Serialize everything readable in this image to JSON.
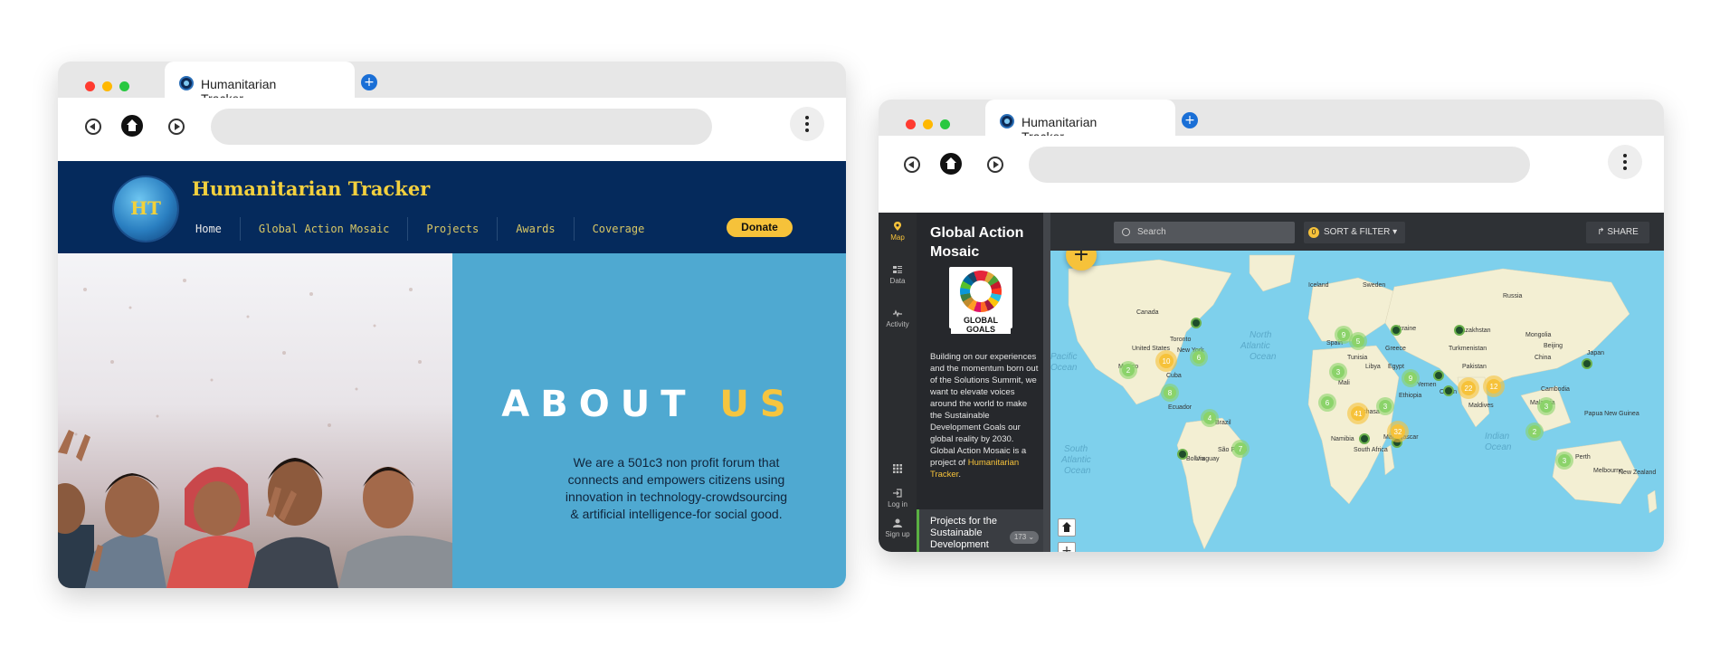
{
  "left_window": {
    "tab_title": "Humanitarian Tracker",
    "site": {
      "title": "Humanitarian Tracker",
      "logo_text": "HT",
      "nav": [
        "Home",
        "Global Action Mosaic",
        "Projects",
        "Awards",
        "Coverage"
      ],
      "donate_label": "Donate",
      "about_heading_part1": "ABOUT",
      "about_heading_part2": "US",
      "about_text": "We are a 501c3 non profit forum that connects and empowers citizens using innovation in technology-crowdsourcing & artificial intelligence-for social good."
    }
  },
  "right_window": {
    "tab_title": "Humanitarian Tracker",
    "rail": [
      {
        "label": "Map",
        "icon": "map-pin-icon"
      },
      {
        "label": "Data",
        "icon": "list-icon"
      },
      {
        "label": "Activity",
        "icon": "activity-icon"
      }
    ],
    "rail_bottom": [
      {
        "label": "",
        "icon": "apps-grid-icon"
      },
      {
        "label": "Log in",
        "icon": "login-icon"
      },
      {
        "label": "Sign up",
        "icon": "user-icon"
      }
    ],
    "panel": {
      "title": "Global Action Mosaic",
      "sdg_label": "GLOBAL GOALS",
      "description": "Building on our experiences and the momentum born out of the Solutions Summit, we want to elevate voices around the world to make the Sustainable Development Goals our global reality by 2030. Global Action Mosaic is a project of",
      "link_text": "Humanitarian Tracker",
      "link_suffix": ".",
      "projects_title": "Projects for the Sustainable Development",
      "projects_count": "173"
    },
    "map": {
      "search_placeholder": "Search",
      "filter_count": "0",
      "sort_filter_label": "SORT & FILTER",
      "share_label": "SHARE",
      "labels": [
        "Canada",
        "Iceland",
        "Sweden",
        "Russia",
        "Ukraine",
        "Kazakhstan",
        "Mongolia",
        "Spain",
        "Tunisia",
        "Libya",
        "Egypt",
        "Greece",
        "Turkmenistan",
        "Pakistan",
        "China",
        "Beijing",
        "Japan",
        "Oman",
        "Yemen",
        "Mali",
        "Ethiopia",
        "Kinshasa",
        "Cambodia",
        "Maldives",
        "Malaysia",
        "Papua New Guinea",
        "Toronto",
        "New York",
        "Cuba",
        "Ecuador",
        "Brazil",
        "Bolivia",
        "São Paulo",
        "Uruguay",
        "Namibia",
        "South Africa",
        "Madagascar",
        "Perth",
        "Melbourne",
        "New Zealand",
        "Mexico",
        "United States",
        "North Atlantic Ocean",
        "South Atlantic Ocean",
        "Indian Ocean",
        "Pacific Ocean"
      ],
      "clusters": [
        {
          "count": "10",
          "color": "yellow"
        },
        {
          "count": "2",
          "color": "green"
        },
        {
          "count": "6",
          "color": "green"
        },
        {
          "count": "8",
          "color": "green"
        },
        {
          "count": "4",
          "color": "green"
        },
        {
          "count": "7",
          "color": "green"
        },
        {
          "count": "9",
          "color": "green"
        },
        {
          "count": "5",
          "color": "green"
        },
        {
          "count": "3",
          "color": "green"
        },
        {
          "count": "6",
          "color": "green"
        },
        {
          "count": "41",
          "color": "yellow"
        },
        {
          "count": "3",
          "color": "green"
        },
        {
          "count": "9",
          "color": "green"
        },
        {
          "count": "32",
          "color": "yellow"
        },
        {
          "count": "22",
          "color": "yellow"
        },
        {
          "count": "12",
          "color": "yellow"
        },
        {
          "count": "3",
          "color": "green"
        },
        {
          "count": "2",
          "color": "green"
        },
        {
          "count": "3",
          "color": "green"
        }
      ]
    }
  },
  "colors": {
    "navy": "#052a5c",
    "gold": "#f3d03e",
    "about_blue": "#4fa9d1",
    "map_water": "#7ed0ec",
    "land": "#f3efd3",
    "cluster_green": "#8bd36a",
    "cluster_yellow": "#f6c23a"
  }
}
